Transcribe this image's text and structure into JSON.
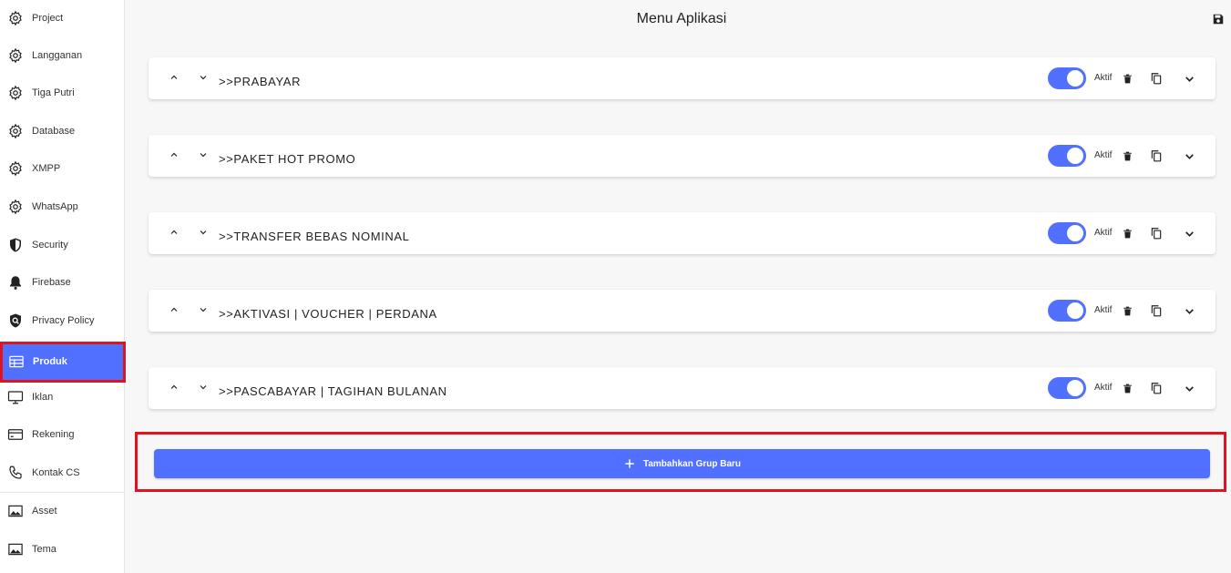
{
  "header": {
    "title": "Menu Aplikasi",
    "save_icon": "save-icon"
  },
  "sidebar": {
    "items": [
      {
        "label": "Project",
        "icon": "gear-icon"
      },
      {
        "label": "Langganan",
        "icon": "gear-icon"
      },
      {
        "label": "Tiga Putri",
        "icon": "gear-icon"
      },
      {
        "label": "Database",
        "icon": "gear-icon"
      },
      {
        "label": "XMPP",
        "icon": "gear-icon"
      },
      {
        "label": "WhatsApp",
        "icon": "gear-icon"
      },
      {
        "label": "Security",
        "icon": "shield-icon"
      },
      {
        "label": "Firebase",
        "icon": "bell-icon"
      },
      {
        "label": "Privacy Policy",
        "icon": "privacy-shield-icon"
      },
      {
        "label": "Produk",
        "icon": "table-icon",
        "active": true
      },
      {
        "label": "Iklan",
        "icon": "monitor-icon"
      },
      {
        "label": "Rekening",
        "icon": "credit-card-icon"
      },
      {
        "label": "Kontak CS",
        "icon": "phone-icon"
      },
      {
        "label": "Asset",
        "icon": "image-icon"
      },
      {
        "label": "Tema",
        "icon": "image-icon"
      }
    ]
  },
  "groups": [
    {
      "title": ">>PRABAYAR",
      "status": "Aktif",
      "enabled": true
    },
    {
      "title": ">>PAKET HOT PROMO",
      "status": "Aktif",
      "enabled": true
    },
    {
      "title": ">>TRANSFER BEBAS NOMINAL",
      "status": "Aktif",
      "enabled": true
    },
    {
      "title": ">>AKTIVASI | VOUCHER | PERDANA",
      "status": "Aktif",
      "enabled": true
    },
    {
      "title": ">>PASCABAYAR | TAGIHAN BULANAN",
      "status": "Aktif",
      "enabled": true
    }
  ],
  "add_group": {
    "label": "Tambahkan Grup Baru",
    "icon": "plus-icon"
  },
  "colors": {
    "accent": "#5270ff",
    "highlight": "#e0141e"
  }
}
